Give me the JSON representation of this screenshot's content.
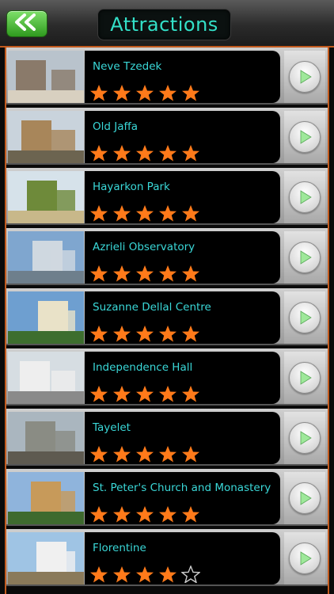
{
  "header": {
    "title": "Attractions",
    "back_icon": "double-chevron-left-icon",
    "accent": "#c25a1e",
    "title_color": "#33e0c8"
  },
  "attractions": [
    {
      "name": "Neve Tzedek",
      "rating": 5
    },
    {
      "name": "Old Jaffa",
      "rating": 5
    },
    {
      "name": "Hayarkon Park",
      "rating": 5
    },
    {
      "name": "Azrieli Observatory",
      "rating": 5
    },
    {
      "name": "Suzanne Dellal Centre",
      "rating": 5
    },
    {
      "name": "Independence Hall",
      "rating": 5
    },
    {
      "name": "Tayelet",
      "rating": 5
    },
    {
      "name": "St. Peter's Church and Monastery",
      "rating": 5
    },
    {
      "name": "Florentine",
      "rating": 4
    }
  ],
  "colors": {
    "star_filled": "#ff7a1a",
    "star_empty_outline": "#cccccc",
    "name_text": "#3ad8d8",
    "go_arrow": "#9ee89a"
  }
}
